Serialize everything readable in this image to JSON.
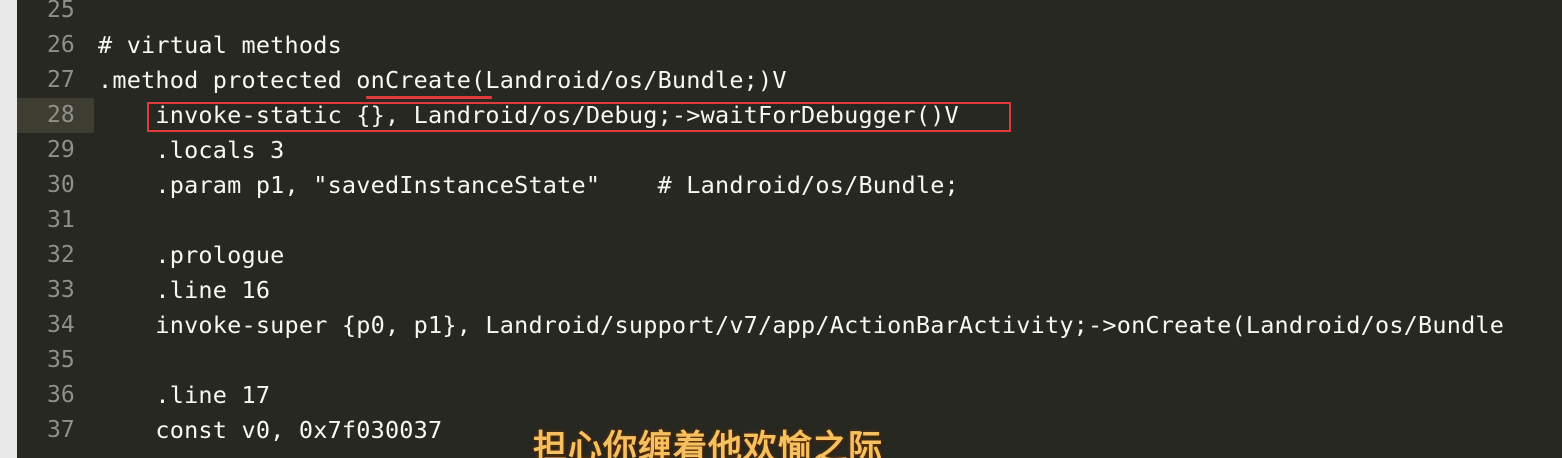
{
  "editor": {
    "lines": [
      {
        "number": "25",
        "code": ""
      },
      {
        "number": "26",
        "code": "# virtual methods"
      },
      {
        "number": "27",
        "code": ".method protected onCreate(Landroid/os/Bundle;)V"
      },
      {
        "number": "28",
        "code": "    invoke-static {}, Landroid/os/Debug;->waitForDebugger()V"
      },
      {
        "number": "29",
        "code": "    .locals 3"
      },
      {
        "number": "30",
        "code": "    .param p1, \"savedInstanceState\"    # Landroid/os/Bundle;"
      },
      {
        "number": "31",
        "code": ""
      },
      {
        "number": "32",
        "code": "    .prologue"
      },
      {
        "number": "33",
        "code": "    .line 16"
      },
      {
        "number": "34",
        "code": "    invoke-super {p0, p1}, Landroid/support/v7/app/ActionBarActivity;->onCreate(Landroid/os/Bundle"
      },
      {
        "number": "35",
        "code": ""
      },
      {
        "number": "36",
        "code": "    .line 17"
      },
      {
        "number": "37",
        "code": "    const v0, 0x7f030037"
      }
    ],
    "active_line": "28"
  },
  "overlay": {
    "subtitle": "担心你缠着他欢愉之际"
  },
  "colors": {
    "background": "#272822",
    "text": "#f8f8f2",
    "line_number": "#8f908a",
    "annotation": "#e03a3a"
  }
}
